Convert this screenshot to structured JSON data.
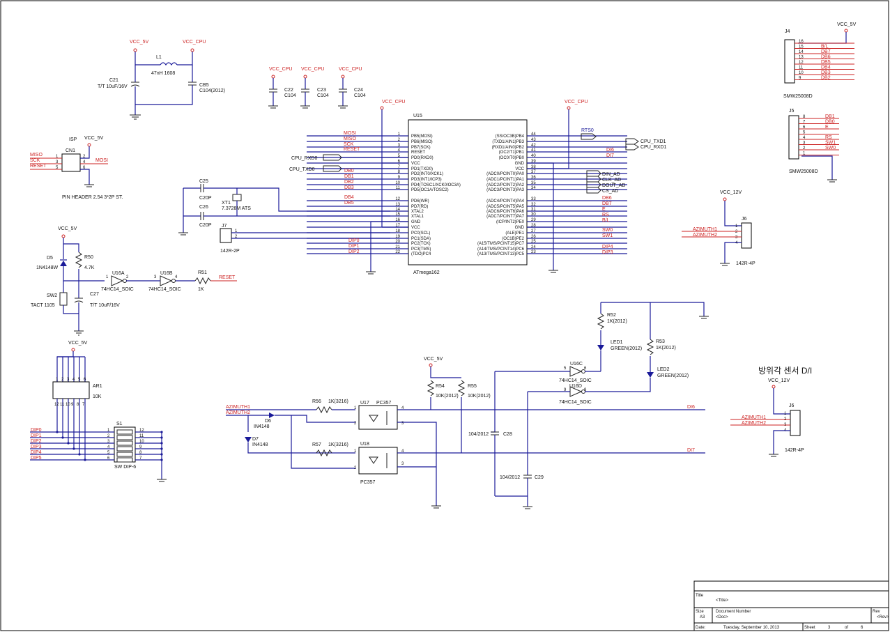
{
  "power": {
    "vcc_5v": "VCC_5V",
    "vcc_cpu": "VCC_CPU",
    "vcc_12v": "VCC_12V"
  },
  "l1": {
    "ref": "L1",
    "value": "47nH 1608"
  },
  "c21": {
    "ref": "C21",
    "value": "T/T 10uF/16V"
  },
  "cb5": {
    "ref": "CB5",
    "value": "C104(2012)"
  },
  "c22": {
    "ref": "C22",
    "value": "C104"
  },
  "c23": {
    "ref": "C23",
    "value": "C104"
  },
  "c24": {
    "ref": "C24",
    "value": "C104"
  },
  "c25": {
    "ref": "C25",
    "value": "C20P"
  },
  "c26": {
    "ref": "C26",
    "value": "C20P"
  },
  "xt1": {
    "ref": "XT1",
    "value": "7.3728M ATS"
  },
  "j7": {
    "ref": "J7",
    "value": "142R-2P"
  },
  "isp": {
    "title": "ISP",
    "ref": "CN1",
    "desc": "PIN HEADER 2.54 3*2P ST.",
    "nets": [
      "MISO",
      "SCK",
      "RESET",
      "MOSI"
    ]
  },
  "reset_ckt": {
    "d5": "D5",
    "d5v": "1N4148W",
    "r50": "R50",
    "r50v": "4.7K",
    "sw2": "SW2",
    "sw2v": "TACT 1105",
    "c27": "C27",
    "c27v": "T/T 10uF/16V",
    "u16a": "U16A",
    "u16b": "U16B",
    "u16v": "74HC14_SOIC",
    "r51": "R51",
    "r51v": "1K",
    "reset": "RESET"
  },
  "mcu": {
    "ref": "U15",
    "part": "ATmega162",
    "left_nets": [
      "MOSI",
      "MISO",
      "SCK",
      "RESET",
      "CPU_RXD0",
      "CPU_TXD0",
      "DB0",
      "DB1",
      "DB2",
      "DB3",
      "DB4",
      "DB5",
      "DIP0",
      "DIP1",
      "DIP2"
    ],
    "right_nets": [
      "RTS0",
      "CPU_TXD1",
      "CPU_RXD1",
      "DI6",
      "DI7",
      "DIN_AD",
      "CLK_AD",
      "DOUT_AD",
      "CS_AD",
      "DB6",
      "DB7",
      "E",
      "RS",
      "B/L",
      "SW0",
      "SW1",
      "DIP4",
      "DIP3"
    ]
  },
  "mcu_left": [
    {
      "n": "1",
      "p": "PB5(MOSI)"
    },
    {
      "n": "2",
      "p": "PB6(MISO)"
    },
    {
      "n": "3",
      "p": "PB7(SCK)"
    },
    {
      "n": "4",
      "p": "RESET"
    },
    {
      "n": "5",
      "p": "PD0(RXD0)"
    },
    {
      "n": "6",
      "p": "VCC"
    },
    {
      "n": "7",
      "p": "PD1(TXD0)"
    },
    {
      "n": "8",
      "p": "PD2(INT0/XCK1)"
    },
    {
      "n": "9",
      "p": "PD3(INT1/ICP3)"
    },
    {
      "n": "10",
      "p": "PD4(TOSC1/XCK0/OC3A)"
    },
    {
      "n": "11",
      "p": "PD5(OC1A/TOSC2)"
    },
    {
      "n": "12",
      "p": "PD6(WR)"
    },
    {
      "n": "13",
      "p": "PD7(RD)"
    },
    {
      "n": "14",
      "p": "XTAL2"
    },
    {
      "n": "15",
      "p": "XTAL1"
    },
    {
      "n": "16",
      "p": "GND"
    },
    {
      "n": "17",
      "p": "VCC"
    },
    {
      "n": "18",
      "p": "PC0(SCL)"
    },
    {
      "n": "19",
      "p": "PC1(SDA)"
    },
    {
      "n": "20",
      "p": "PC2(TCK)"
    },
    {
      "n": "21",
      "p": "PC3(TMS)"
    },
    {
      "n": "22",
      "p": "(TDO)PC4"
    }
  ],
  "mcu_right": [
    {
      "n": "44",
      "p": "(SS/OC3B)PB4"
    },
    {
      "n": "43",
      "p": "(TXD1/AIN1)PB3"
    },
    {
      "n": "42",
      "p": "(RXD1/AIN0)PB2"
    },
    {
      "n": "41",
      "p": "(OC2/T1)PB1"
    },
    {
      "n": "40",
      "p": "(OC0/T0)PB0"
    },
    {
      "n": "39",
      "p": "GND"
    },
    {
      "n": "38",
      "p": "VCC"
    },
    {
      "n": "37",
      "p": "(ADC0/PCINT0)PA0"
    },
    {
      "n": "36",
      "p": "(ADC1/PCINT1)PA1"
    },
    {
      "n": "35",
      "p": "(ADC2/PCINT2)PA2"
    },
    {
      "n": "34",
      "p": "(ADC3/PCINT3)PA3"
    },
    {
      "n": "33",
      "p": "(ADC4/PCINT4)PA4"
    },
    {
      "n": "32",
      "p": "(ADC5/PCINT5)PA5"
    },
    {
      "n": "31",
      "p": "(ADC6/PCINT6)PA6"
    },
    {
      "n": "30",
      "p": "(ADC7/PCINT7)PA7"
    },
    {
      "n": "29",
      "p": "(ICP/INT2)PE0"
    },
    {
      "n": "28",
      "p": "GND"
    },
    {
      "n": "27",
      "p": "(ALE)PE1"
    },
    {
      "n": "26",
      "p": "(OC1B)PE2"
    },
    {
      "n": "25",
      "p": "(A15/TMS/PCINT15)PC7"
    },
    {
      "n": "24",
      "p": "(A14/TMS/PCINT14)PC6"
    },
    {
      "n": "23",
      "p": "(A13/TMS/PCINT13)PC5"
    }
  ],
  "j4": {
    "ref": "J4",
    "value": "SMW25008D",
    "pins": [
      "16",
      "15",
      "14",
      "13",
      "12",
      "11",
      "10",
      "9"
    ],
    "nets": [
      "",
      "B/L",
      "DB7",
      "DB6",
      "DB5",
      "DB4",
      "DB3",
      "DB2"
    ]
  },
  "j5": {
    "ref": "J5",
    "value": "SMW25008D",
    "pins": [
      "8",
      "7",
      "6",
      "5",
      "4",
      "3",
      "2",
      "1"
    ],
    "nets": [
      "DB1",
      "DB0",
      "E",
      "",
      "RS",
      "SW1",
      "SW0",
      ""
    ]
  },
  "j6": {
    "ref": "J6",
    "value": "142R-4P",
    "pins": [
      "1",
      "2",
      "3",
      "4"
    ],
    "nets": [
      "AZIMUTH1",
      "AZIMUTH2"
    ]
  },
  "j6b": {
    "ref": "J6",
    "value": "142R-4P",
    "pins": [
      "1",
      "2",
      "3",
      "4"
    ],
    "nets": [
      "AZIMUTH1",
      "AZIMUTH2"
    ],
    "title": "방위각 센서 D/I"
  },
  "ar1": {
    "ref": "AR1",
    "value": "10K",
    "pins_top": [
      "1",
      "2",
      "3",
      "4",
      "5",
      "6"
    ],
    "pins_bot": [
      "12",
      "11",
      "10",
      "9",
      "8",
      "7"
    ]
  },
  "s1": {
    "ref": "S1",
    "value": "SW DIP-6",
    "left": [
      "1",
      "2",
      "3",
      "4",
      "5",
      "6"
    ],
    "right": [
      "12",
      "11",
      "10",
      "9",
      "8",
      "7"
    ],
    "nets": [
      "DIP0",
      "DIP1",
      "DIP2",
      "DIP3",
      "DIP4",
      "DIP5"
    ]
  },
  "opto": {
    "r56": "R56",
    "r56v": "1K(3216)",
    "r57": "R57",
    "r57v": "1K(3216)",
    "u17": "U17",
    "u18": "U18",
    "pc": "PC357",
    "d6": "D6",
    "d6v": "IN4148",
    "d7": "D7",
    "d7v": "IN4148",
    "r54": "R54",
    "r54v": "10K(2012)",
    "r55": "R55",
    "r55v": "10K(2012)",
    "c28": "C28",
    "c28v": "104/2012",
    "c29": "C29",
    "c29v": "104/2012",
    "az1": "AZIMUTH1",
    "az2": "AZIMUTH2",
    "di6": "DI6",
    "di7": "DI7"
  },
  "leds": {
    "r52": "R52",
    "r52v": "1K(2012)",
    "r53": "R53",
    "r53v": "1K(2012)",
    "led1": "LED1",
    "led1v": "GREEN(2012)",
    "led2": "LED2",
    "led2v": "GREEN(2012)",
    "u16c": "U16C",
    "u16d": "U16D",
    "u16v": "74HC14_SOIC"
  },
  "titleblock": {
    "title_lbl": "Title",
    "title": "<Title>",
    "size_lbl": "Size",
    "size": "A3",
    "doc_lbl": "Document Number",
    "doc": "<Doc>",
    "rev_lbl": "Rev",
    "rev": "<Rev>",
    "date_lbl": "Date:",
    "date": "Tuesday, September 10, 2013",
    "sheet_lbl": "Sheet",
    "sheet": "3",
    "of": "of",
    "sheets": "6"
  }
}
